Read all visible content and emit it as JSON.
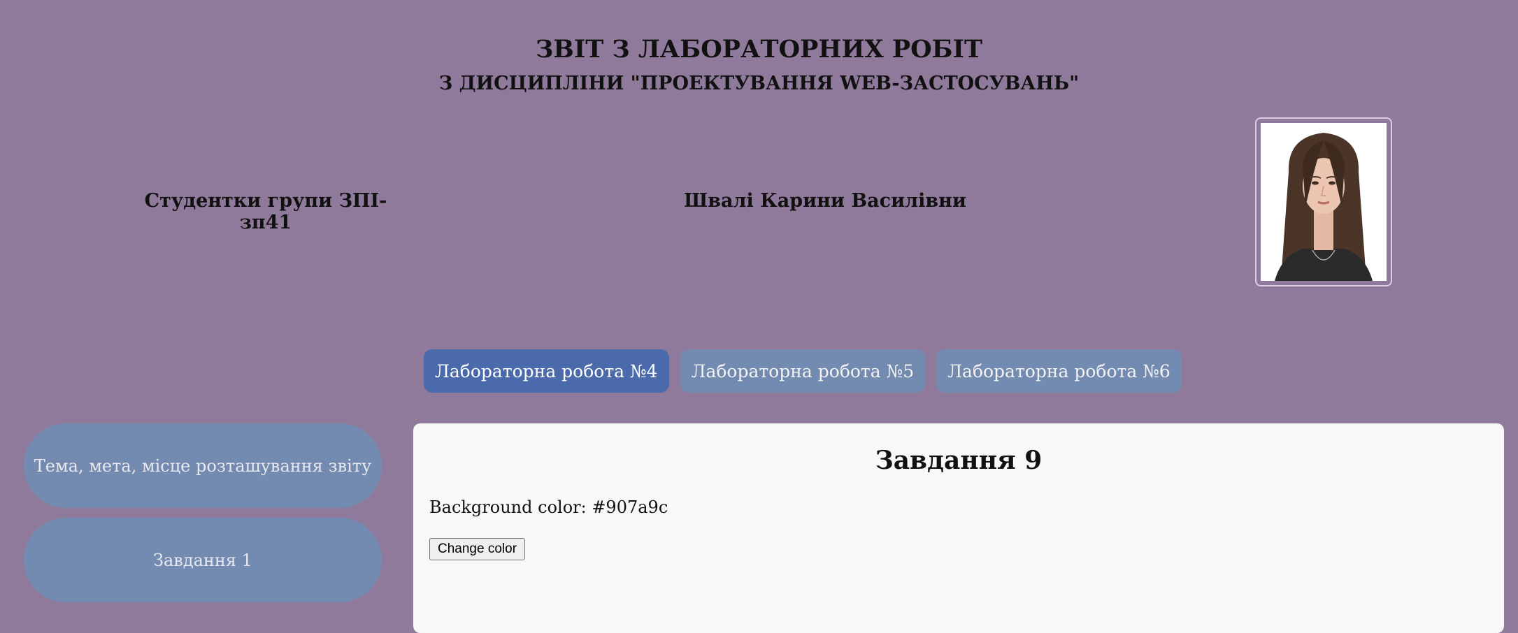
{
  "header": {
    "title": "ЗВІТ З ЛАБОРАТОРНИХ РОБІТ",
    "subtitle": "З ДИСЦИПЛІНИ \"ПРОЕКТУВАННЯ WEB-ЗАСТОСУВАНЬ\""
  },
  "student": {
    "group": "Студентки групи ЗПІ-зп41",
    "name": "Швалі Карини Василівни",
    "photo_icon": "student-photo"
  },
  "tabs": [
    {
      "label": "Лабораторна робота №4",
      "active": true
    },
    {
      "label": "Лабораторна робота №5",
      "active": false
    },
    {
      "label": "Лабораторна робота №6",
      "active": false
    }
  ],
  "sidebar": {
    "items": [
      {
        "label": "Тема, мета, місце розташування звіту"
      },
      {
        "label": "Завдання 1"
      }
    ]
  },
  "content": {
    "title": "Завдання 9",
    "background_label": "Background color: #907a9c",
    "change_button": "Change color"
  },
  "colors": {
    "page_background": "#907a9c",
    "tab_active": "#4a6aac",
    "tab_inactive": "#738bb0",
    "sidebar_item": "#738bb0",
    "content_panel": "#f8f8f8"
  }
}
